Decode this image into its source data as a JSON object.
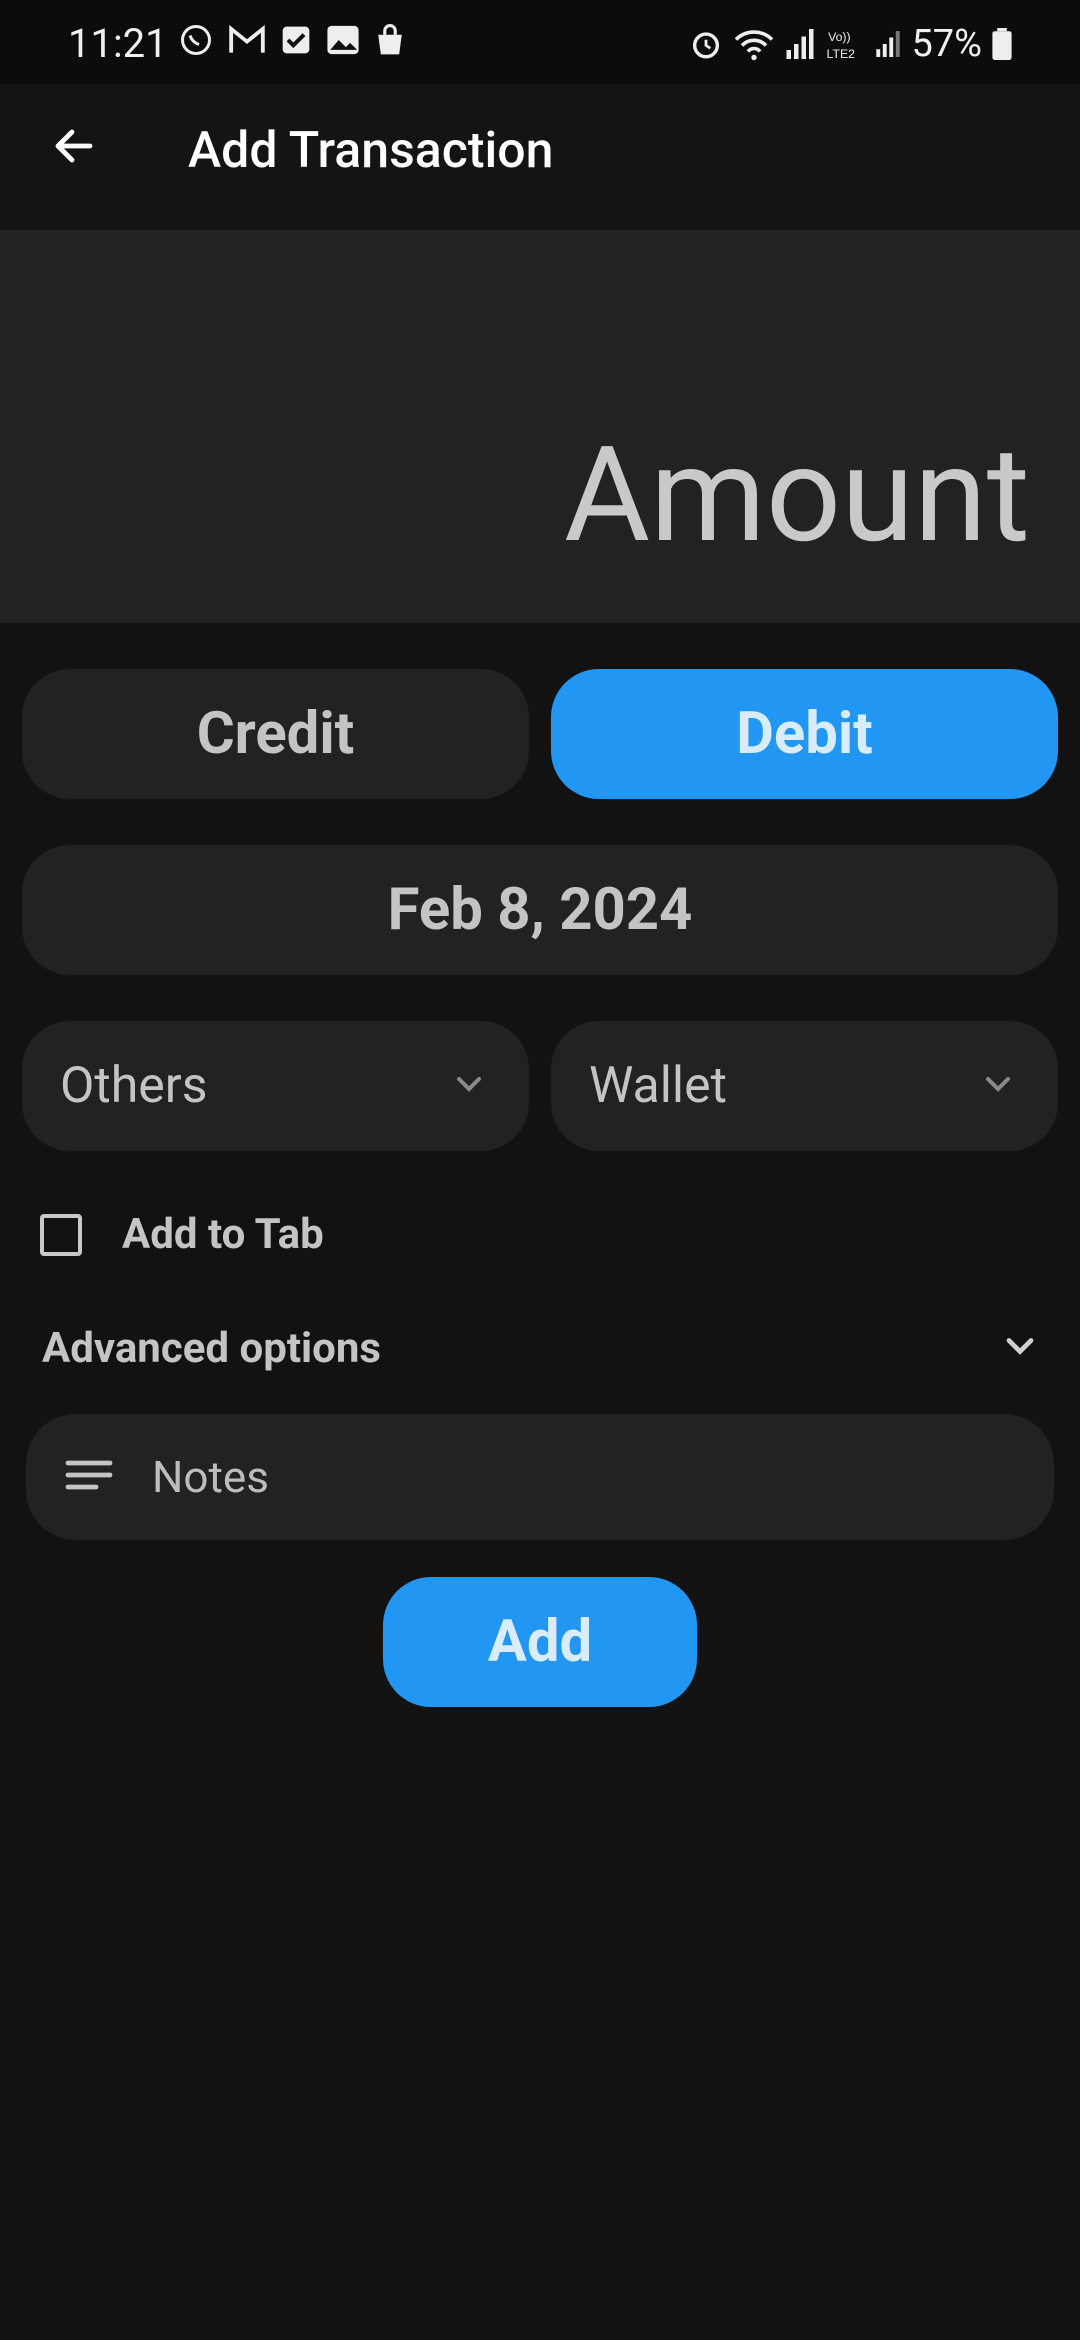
{
  "status_bar": {
    "time": "11:21",
    "battery": "57%",
    "left_icons": [
      "whatsapp-icon",
      "gmail-icon",
      "tasks-icon",
      "gallery-icon",
      "shopping-bag-icon"
    ],
    "right_icons": [
      "alarm-icon",
      "wifi-icon",
      "signal-icon",
      "volte-icon",
      "signal-icon",
      "battery-icon"
    ]
  },
  "app_bar": {
    "title": "Add Transaction",
    "back_icon": "arrow-left-icon"
  },
  "amount": {
    "placeholder": "Amount"
  },
  "type_toggle": {
    "credit_label": "Credit",
    "debit_label": "Debit",
    "selected": "Debit"
  },
  "date": {
    "value": "Feb 8, 2024"
  },
  "category": {
    "value": "Others"
  },
  "account": {
    "value": "Wallet"
  },
  "add_to_tab": {
    "label": "Add to Tab",
    "checked": false
  },
  "advanced": {
    "label": "Advanced options",
    "icon": "chevron-down-icon"
  },
  "notes": {
    "placeholder": "Notes",
    "icon": "notes-icon"
  },
  "submit": {
    "label": "Add"
  },
  "colors": {
    "accent": "#2196f3",
    "background": "#121212",
    "surface": "#222222"
  }
}
